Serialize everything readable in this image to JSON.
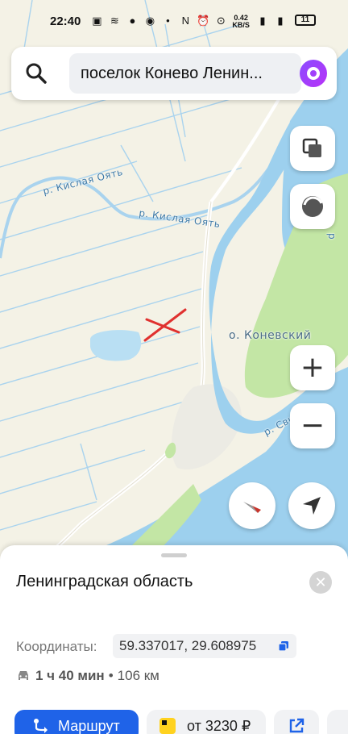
{
  "status_bar": {
    "time": "22:40",
    "net_speed": "0.42",
    "net_unit": "KB/S",
    "battery": "11"
  },
  "search": {
    "query": "поселок Конево Ленин..."
  },
  "map": {
    "labels": {
      "river_1": "р. Кислая Оять",
      "river_2": "р. Кислая Оять",
      "island": "о. Коневский",
      "river_svir": "р. Сви",
      "river_right": "р"
    },
    "colors": {
      "land": "#f4f2e6",
      "water": "#9dd0ee",
      "canals": "#a9d3ee",
      "forest": "#c3e6a5",
      "marker": "#e0312f"
    }
  },
  "controls": {
    "zoom_in": "+",
    "zoom_out": "−"
  },
  "place": {
    "title": "Ленинградская область",
    "coords_label": "Координаты:",
    "coords_value": "59.337017, 29.608975",
    "route_time": "1 ч 40 мин",
    "route_sep": "•",
    "route_distance": "106 км"
  },
  "actions": {
    "route_label": "Маршрут",
    "taxi_label": "от 3230 ₽"
  }
}
